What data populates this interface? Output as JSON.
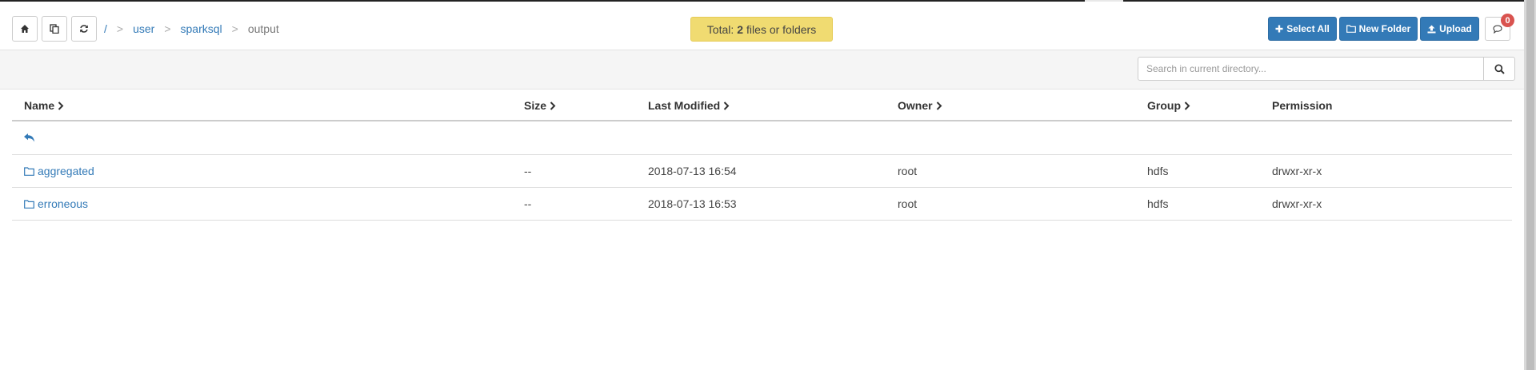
{
  "toolbar": {
    "home_icon": "home-icon",
    "copy_icon": "copy-icon",
    "refresh_icon": "refresh-icon"
  },
  "breadcrumb": {
    "root": "/",
    "items": [
      "user",
      "sparksql"
    ],
    "current": "output"
  },
  "summary": {
    "prefix": "Total:",
    "count": "2",
    "suffix": "files or folders"
  },
  "actions": {
    "select_all": "Select All",
    "new_folder": "New Folder",
    "upload": "Upload",
    "notifications_count": "0"
  },
  "search": {
    "placeholder": "Search in current directory..."
  },
  "table": {
    "columns": [
      "Name",
      "Size",
      "Last Modified",
      "Owner",
      "Group",
      "Permission"
    ],
    "rows": [
      {
        "name": "aggregated",
        "size": "--",
        "modified": "2018-07-13 16:54",
        "owner": "root",
        "group": "hdfs",
        "permission": "drwxr-xr-x"
      },
      {
        "name": "erroneous",
        "size": "--",
        "modified": "2018-07-13 16:53",
        "owner": "root",
        "group": "hdfs",
        "permission": "drwxr-xr-x"
      }
    ]
  },
  "colors": {
    "link": "#337ab7",
    "badge": "#f0db71",
    "danger": "#d9534f"
  }
}
